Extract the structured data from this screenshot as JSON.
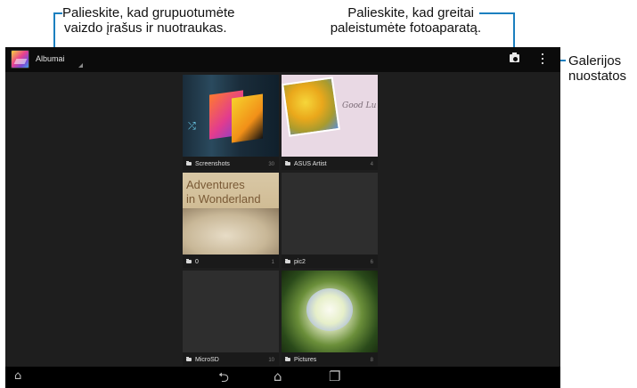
{
  "callouts": {
    "left": {
      "line1": "Palieskite, kad grupuotumėte",
      "line2": "vaizdo įrašus ir nuotraukas."
    },
    "center": {
      "line1": "Palieskite, kad greitai",
      "line2": "paleistumėte fotoaparatą."
    },
    "right": {
      "line1": "Galerijos",
      "line2": "nuostatos"
    }
  },
  "actionbar": {
    "title": "Albumai",
    "icons": [
      "gallery-app-icon",
      "camera-icon",
      "overflow-menu-icon"
    ]
  },
  "albums": [
    {
      "name": "Screenshots",
      "count": "30"
    },
    {
      "name": "ASUS Artist",
      "count": "4"
    },
    {
      "name": "0",
      "count": "1",
      "cover_text": [
        "Adventures",
        "in Wonderland"
      ]
    },
    {
      "name": "pic2",
      "count": "6"
    },
    {
      "name": "MicroSD",
      "count": "10"
    },
    {
      "name": "Pictures",
      "count": "8"
    }
  ],
  "thumbnail_text": {
    "asus_artist": "Good Lu"
  },
  "navbar": {
    "icons": [
      "home-icon",
      "back-icon",
      "home-button-icon",
      "recent-apps-icon"
    ]
  },
  "colors": {
    "callout_accent": "#1b7fbf",
    "background": "#1e1e1e",
    "actionbar": "#0b0b0b"
  }
}
